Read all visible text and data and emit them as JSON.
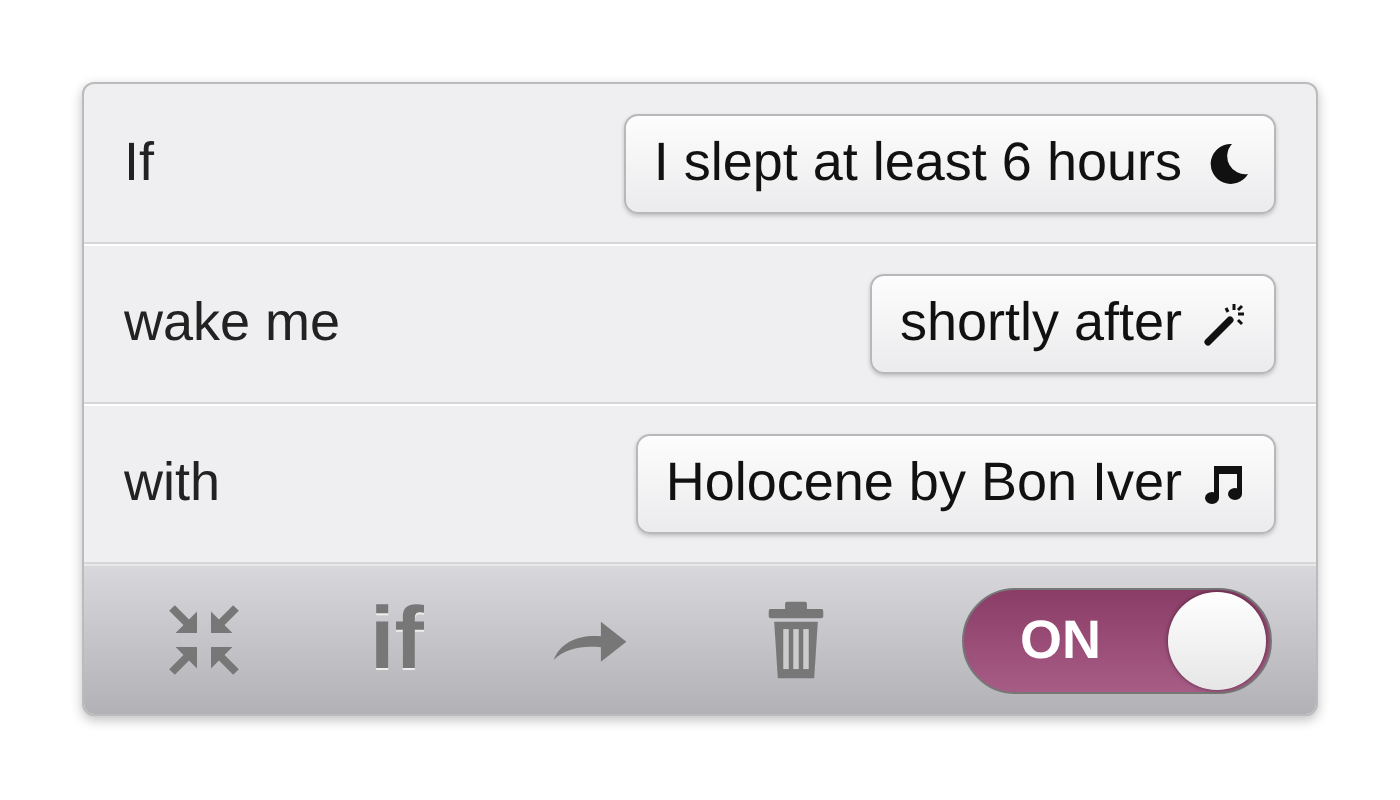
{
  "rules": [
    {
      "label": "If",
      "value": "I slept at least 6 hours"
    },
    {
      "label": "wake me",
      "value": "shortly after"
    },
    {
      "label": "with",
      "value": "Holocene by Bon Iver"
    }
  ],
  "toolbar": {
    "if_button": "if",
    "toggle": {
      "label": "ON",
      "on": true
    }
  }
}
